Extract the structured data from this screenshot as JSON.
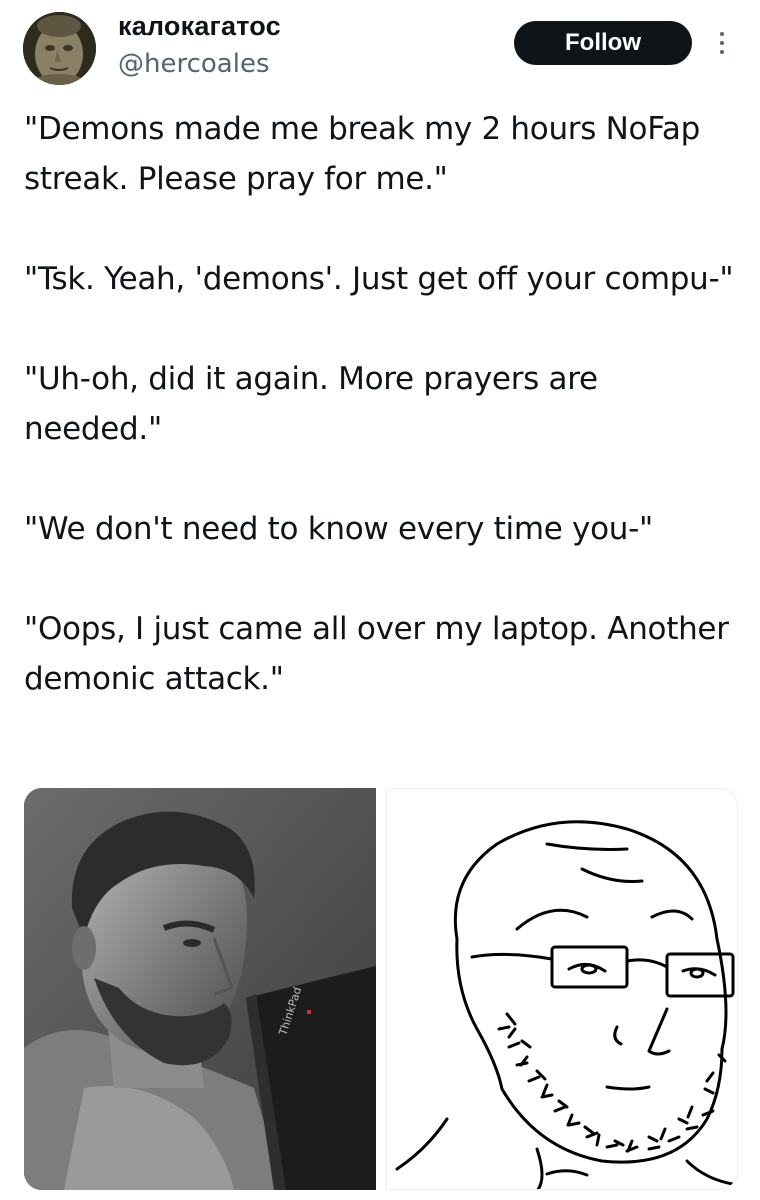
{
  "author": {
    "display_name": "калокагатос",
    "handle": "@hercoales",
    "avatar_icon": "avatar-statue-face"
  },
  "actions": {
    "follow_label": "Follow",
    "more_icon": "more-vertical-icon"
  },
  "tweet": {
    "paragraphs": [
      "\"Demons made me break my 2 hours NoFap streak. Please pray for me.\"",
      "\"Tsk. Yeah, 'demons'. Just get off your compu-\"",
      "\"Uh-oh, did it again. More prayers are needed.\"",
      "\"We don't need to know every time you-\"",
      "\"Oops, I just came all over my laptop. Another demonic attack.\""
    ]
  },
  "media": {
    "left_image": {
      "laptop_brand": "ThinkPad"
    },
    "right_image": {}
  },
  "colors": {
    "text": "#0f1419",
    "secondary": "#536471",
    "button_bg": "#0f1419",
    "button_text": "#ffffff"
  }
}
